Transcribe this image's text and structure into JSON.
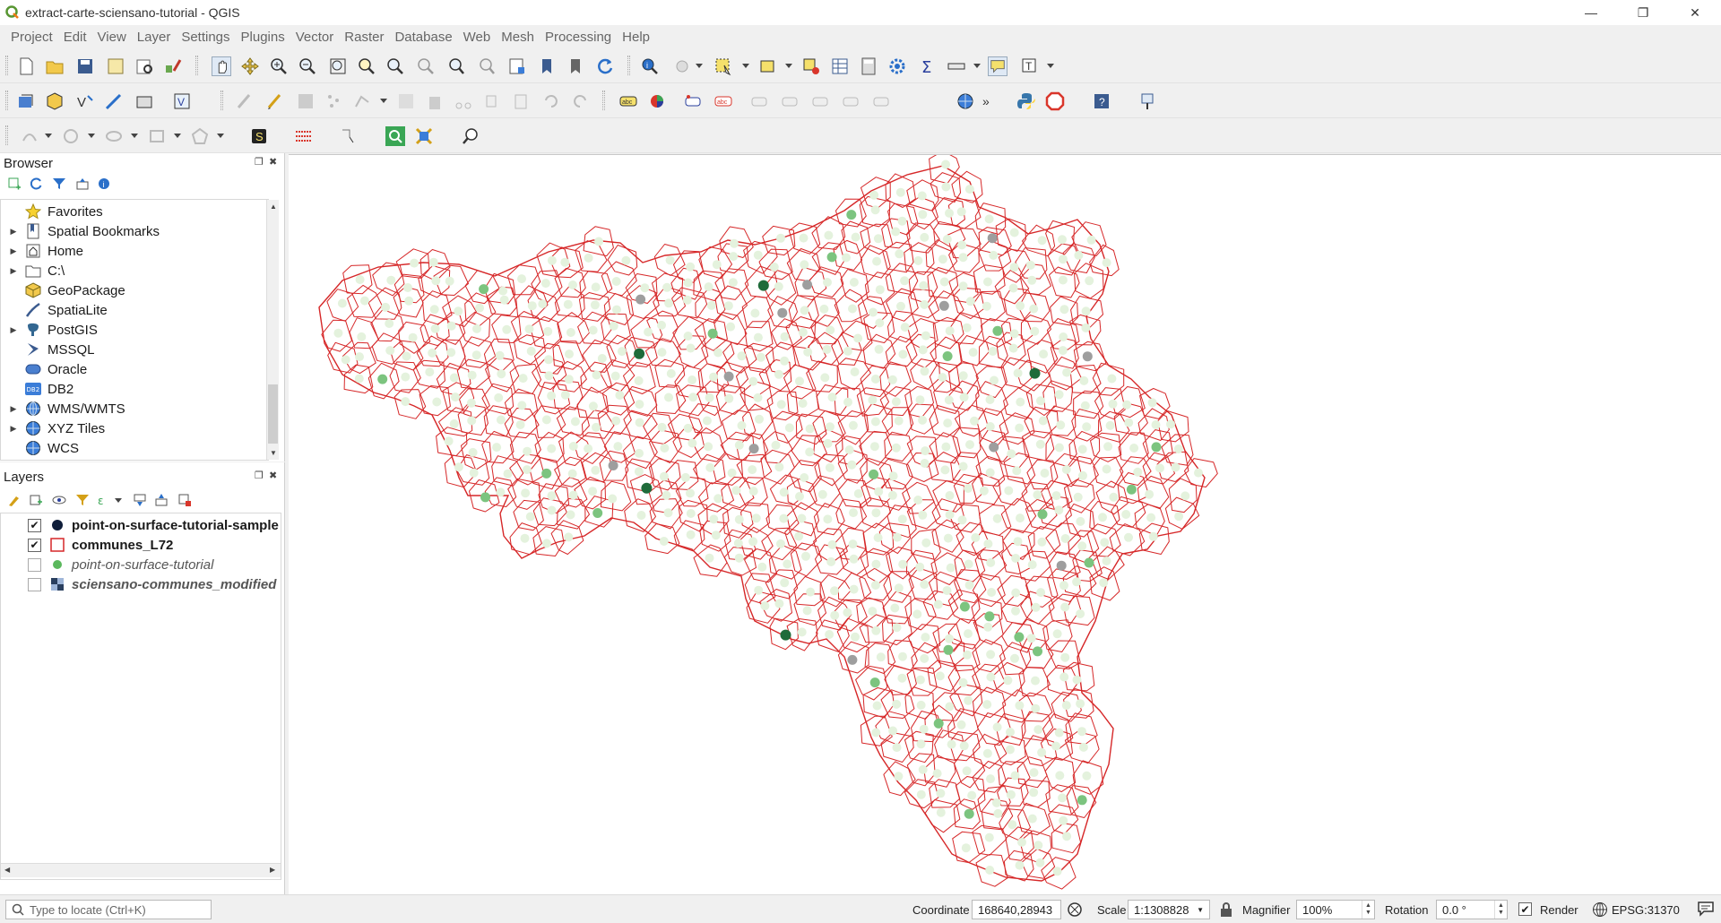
{
  "window": {
    "title": "extract-carte-sciensano-tutorial - QGIS",
    "minimize": "—",
    "restore": "❐",
    "close": "✕"
  },
  "menubar": [
    "Project",
    "Edit",
    "View",
    "Layer",
    "Settings",
    "Plugins",
    "Vector",
    "Raster",
    "Database",
    "Web",
    "Mesh",
    "Processing",
    "Help"
  ],
  "browser": {
    "title": "Browser",
    "items": [
      {
        "label": "Favorites",
        "icon": "star-icon",
        "expandable": false
      },
      {
        "label": "Spatial Bookmarks",
        "icon": "bookmark-icon",
        "expandable": true
      },
      {
        "label": "Home",
        "icon": "home-icon",
        "expandable": true
      },
      {
        "label": "C:\\",
        "icon": "folder-icon",
        "expandable": true
      },
      {
        "label": "GeoPackage",
        "icon": "geopackage-icon",
        "expandable": false
      },
      {
        "label": "SpatiaLite",
        "icon": "spatialite-icon",
        "expandable": false
      },
      {
        "label": "PostGIS",
        "icon": "postgis-icon",
        "expandable": true
      },
      {
        "label": "MSSQL",
        "icon": "mssql-icon",
        "expandable": false
      },
      {
        "label": "Oracle",
        "icon": "oracle-icon",
        "expandable": false
      },
      {
        "label": "DB2",
        "icon": "db2-icon",
        "expandable": false
      },
      {
        "label": "WMS/WMTS",
        "icon": "globe-icon",
        "expandable": true
      },
      {
        "label": "XYZ Tiles",
        "icon": "xyz-icon",
        "expandable": true
      },
      {
        "label": "WCS",
        "icon": "globe-icon",
        "expandable": false
      }
    ]
  },
  "layers": {
    "title": "Layers",
    "items": [
      {
        "label": "point-on-surface-tutorial-sample",
        "checked": true,
        "style": "bold",
        "symbol": "dark-point"
      },
      {
        "label": "communes_L72",
        "checked": true,
        "style": "bold",
        "symbol": "red-polygon"
      },
      {
        "label": "point-on-surface-tutorial",
        "checked": false,
        "style": "italic",
        "symbol": "green-point"
      },
      {
        "label": "sciensano-communes_modified",
        "checked": false,
        "style": "italic",
        "symbol": "raster"
      }
    ]
  },
  "statusbar": {
    "locator_placeholder": "Type to locate (Ctrl+K)",
    "coordinate_label": "Coordinate",
    "coordinate_value": "168640,28943",
    "scale_label": "Scale",
    "scale_value": "1:1308828",
    "magnifier_label": "Magnifier",
    "magnifier_value": "100%",
    "rotation_label": "Rotation",
    "rotation_value": "0.0 °",
    "render_label": "Render",
    "render_checked": true,
    "crs_value": "EPSG:31370"
  },
  "colors": {
    "commune_border": "#d62728",
    "point_light": "#e4f2dd",
    "point_mid": "#7cc47f",
    "point_dark": "#1f6b3a",
    "point_gray": "#9e9e9e"
  }
}
